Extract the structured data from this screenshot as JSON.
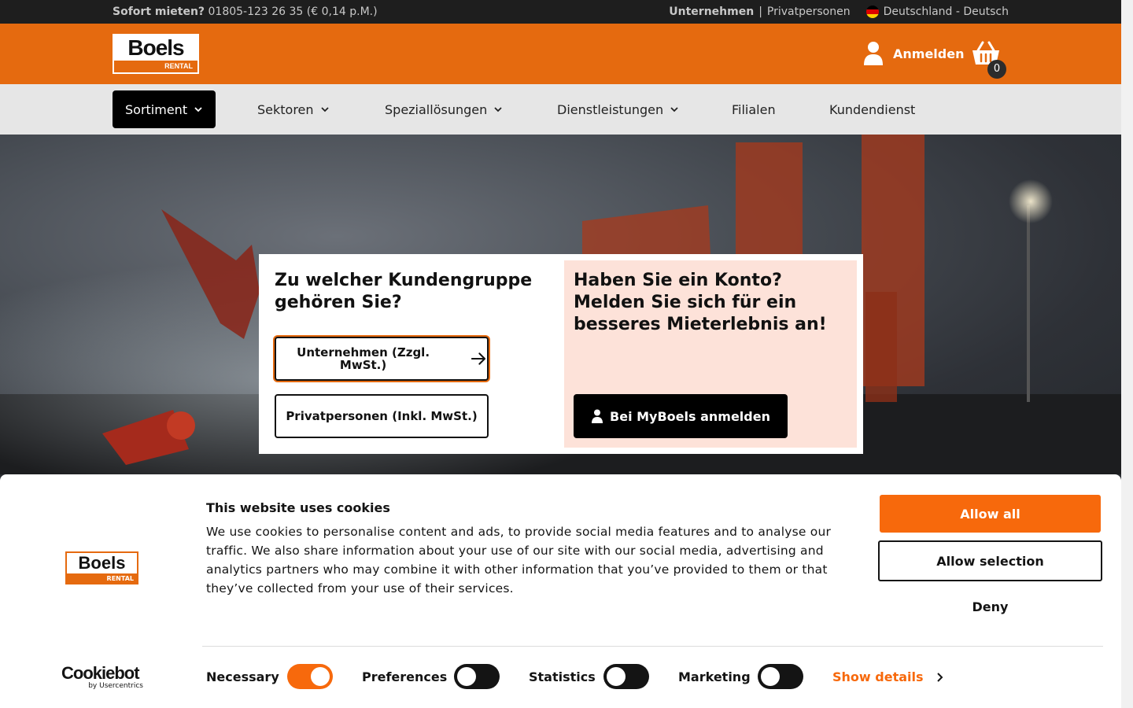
{
  "topbar": {
    "rent_label": "Sofort mieten?",
    "phone": "01805-123 26 35 (€ 0,14 p.M.)",
    "business": "Unternehmen",
    "separator": "|",
    "private": "Privatpersonen",
    "locale": "Deutschland - Deutsch"
  },
  "header": {
    "logo_main": "Boels",
    "logo_sub": "RENTAL",
    "login_label": "Anmelden",
    "cart_count": "0"
  },
  "nav": {
    "items": [
      {
        "label": "Sortiment"
      },
      {
        "label": "Sektoren"
      },
      {
        "label": "Speziallösungen"
      },
      {
        "label": "Dienstleistungen"
      },
      {
        "label": "Filialen"
      },
      {
        "label": "Kundendienst"
      }
    ]
  },
  "modal": {
    "question": "Zu welcher Kundengruppe gehören Sie?",
    "option_business": "Unternehmen (Zzgl. MwSt.)",
    "option_private": "Privatpersonen (Inkl. MwSt.)",
    "account_title": "Haben Sie ein Konto? Melden Sie sich für ein besseres Mieterlebnis an!",
    "login_button": "Bei MyBoels anmelden"
  },
  "cookie": {
    "logo_main": "Boels",
    "logo_sub": "RENTAL",
    "title": "This website uses cookies",
    "text": "We use cookies to personalise content and ads, to provide social media features and to analyse our traffic. We also share information about your use of our site with our social media, advertising and analytics partners who may combine it with other information that you’ve provided to them or that they’ve collected from your use of their services.",
    "allow_all": "Allow all",
    "allow_selection": "Allow selection",
    "deny": "Deny",
    "toggles": [
      {
        "label": "Necessary",
        "on": true
      },
      {
        "label": "Preferences",
        "on": false
      },
      {
        "label": "Statistics",
        "on": false
      },
      {
        "label": "Marketing",
        "on": false
      }
    ],
    "show_details": "Show details",
    "brand_name": "Cookiebot",
    "brand_sub": "by Usercentrics"
  },
  "colors": {
    "brand_orange": "#e56a0f",
    "cookie_orange": "#f7690c",
    "nav_bg": "#e6e6e6",
    "panel_pink": "#fde2d9"
  }
}
